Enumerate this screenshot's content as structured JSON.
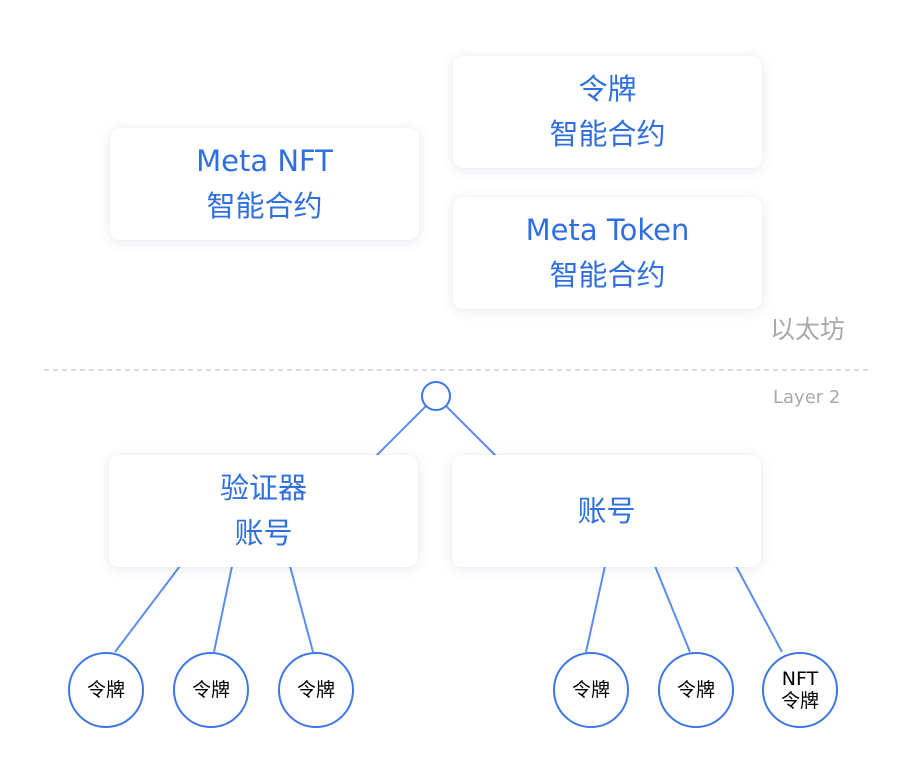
{
  "layers": {
    "top_label": "以太坊",
    "bottom_label": "Layer 2"
  },
  "contracts": {
    "meta_nft": [
      "Meta NFT",
      "智能合约"
    ],
    "token": [
      "令牌",
      "智能合约"
    ],
    "meta_token": [
      "Meta Token",
      "智能合约"
    ]
  },
  "accounts": {
    "validator": [
      "验证器",
      "账号"
    ],
    "account": [
      "账号"
    ]
  },
  "tokens": {
    "validator_tokens": [
      "令牌",
      "令牌",
      "令牌"
    ],
    "account_tokens": [
      "令牌",
      "令牌"
    ],
    "nft_token": [
      "NFT",
      "令牌"
    ]
  },
  "colors": {
    "accent": "#2f6fe0",
    "line": "#5b8def",
    "divider": "#cfcfcf",
    "muted_label": "#a9a9a9"
  }
}
